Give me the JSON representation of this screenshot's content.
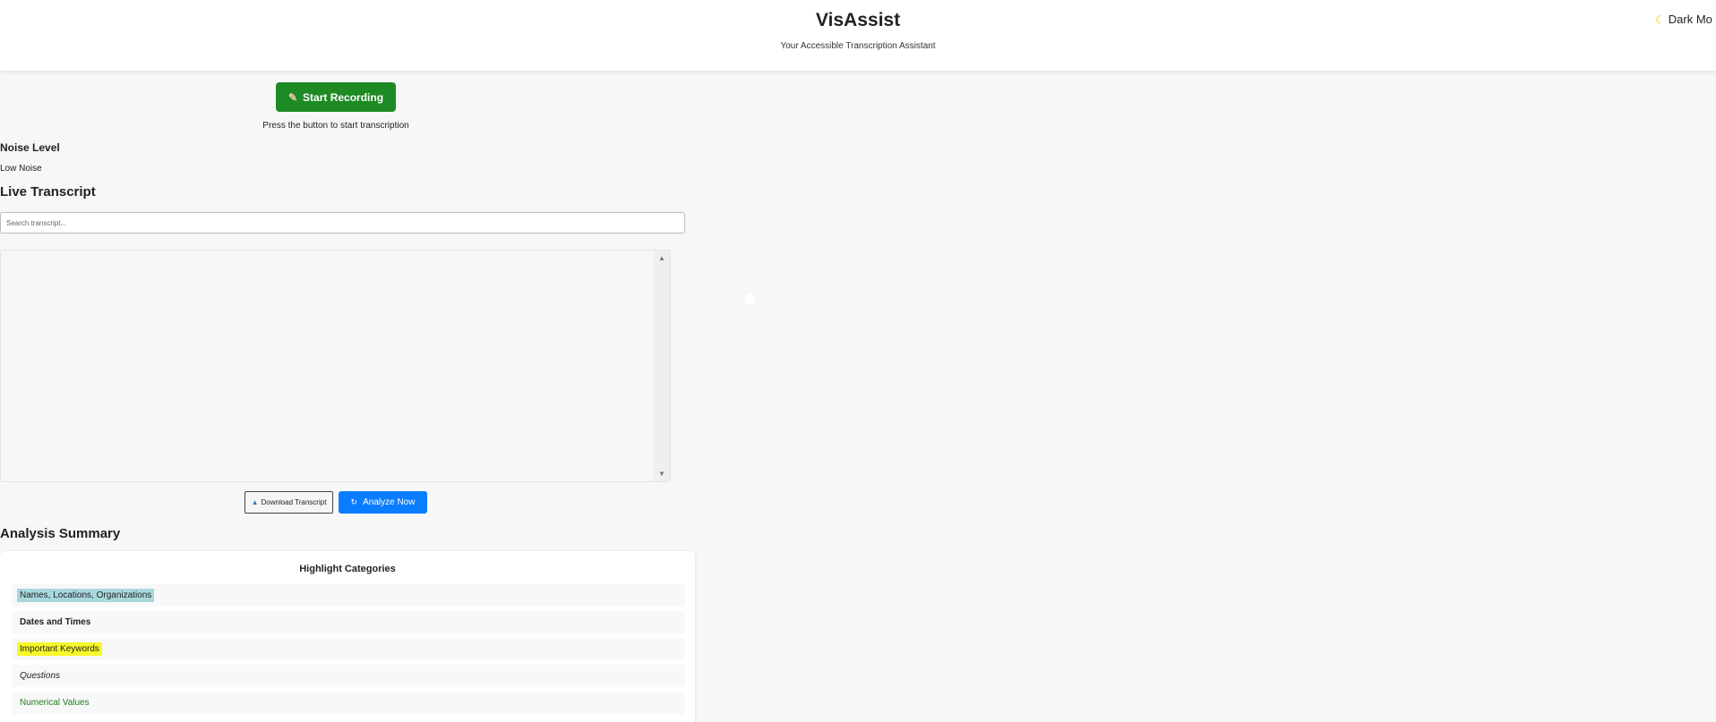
{
  "header": {
    "title": "VisAssist",
    "subtitle": "Your Accessible Transcription Assistant",
    "dark_mode_label": "Dark Mo"
  },
  "recording": {
    "button_label": "Start Recording",
    "hint": "Press the button to start transcription"
  },
  "noise": {
    "title": "Noise Level",
    "value": "Low Noise"
  },
  "transcript": {
    "title": "Live Transcript",
    "search_placeholder": "Search transcript...",
    "search_value": ""
  },
  "actions": {
    "download_label": "Download Transcript",
    "analyze_label": "Analyze Now"
  },
  "summary": {
    "title": "Analysis Summary",
    "card_title": "Highlight Categories",
    "categories": [
      {
        "label": "Names, Locations, Organizations"
      },
      {
        "label": "Dates and Times"
      },
      {
        "label": "Important Keywords"
      },
      {
        "label": "Questions"
      },
      {
        "label": "Numerical Values"
      }
    ]
  },
  "colors": {
    "record_button": "#1e8a24",
    "analyze_button": "#0a7cff",
    "names_highlight": "#a8d8de",
    "keywords_highlight": "#f7f72a",
    "numbers_text": "#1e7d1e"
  }
}
